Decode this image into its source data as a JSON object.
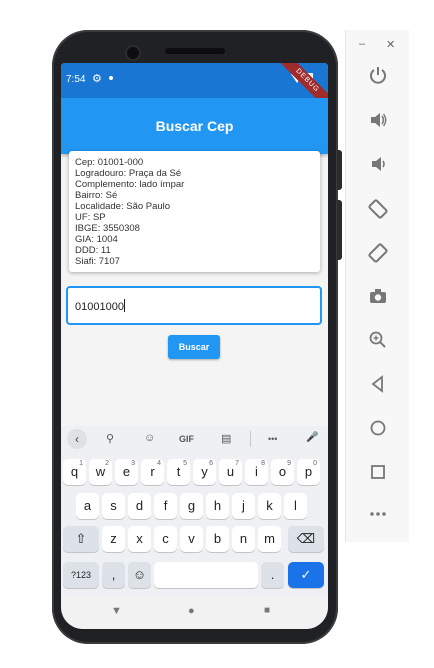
{
  "status_bar": {
    "time": "7:54",
    "debug_label": "DEBUG"
  },
  "app_bar": {
    "title": "Buscar Cep"
  },
  "result_lines": [
    "Cep: 01001-000",
    "Logradouro: Praça da Sé",
    "Complemento: lado ímpar",
    "Bairro: Sé",
    "Localidade: São Paulo",
    "UF: SP",
    "IBGE: 3550308",
    "GIA: 1004",
    "DDD: 11",
    "Siafi: 7107"
  ],
  "cep_input": {
    "value": "01001000"
  },
  "search_button": {
    "label": "Buscar"
  },
  "keyboard": {
    "toolbar": {
      "back": "‹",
      "search": "⚲",
      "sticker": "☺",
      "gif": "GIF",
      "clipboard": "▤",
      "more": "•••",
      "mic": "🎤"
    },
    "row1": [
      {
        "k": "q",
        "s": "1"
      },
      {
        "k": "w",
        "s": "2"
      },
      {
        "k": "e",
        "s": "3"
      },
      {
        "k": "r",
        "s": "4"
      },
      {
        "k": "t",
        "s": "5"
      },
      {
        "k": "y",
        "s": "6"
      },
      {
        "k": "u",
        "s": "7"
      },
      {
        "k": "i",
        "s": "8"
      },
      {
        "k": "o",
        "s": "9"
      },
      {
        "k": "p",
        "s": "0"
      }
    ],
    "row2": [
      "a",
      "s",
      "d",
      "f",
      "g",
      "h",
      "j",
      "k",
      "l"
    ],
    "row3": [
      "z",
      "x",
      "c",
      "v",
      "b",
      "n",
      "m"
    ],
    "shift": "⇧",
    "backspace": "⌫",
    "symbols": "?123",
    "comma": ",",
    "emoji": "☺",
    "period": ".",
    "enter": "✓"
  },
  "nav_bar": {
    "back": "▼",
    "home": "●",
    "recents": "■"
  },
  "emulator_panel": {
    "minimize": "–",
    "close": "✕",
    "icons": [
      "power-icon",
      "volume-up-icon",
      "volume-down-icon",
      "rotate-left-icon",
      "rotate-right-icon",
      "camera-icon",
      "zoom-icon",
      "back-icon",
      "home-icon",
      "overview-icon",
      "more-icon"
    ]
  },
  "colors": {
    "primary": "#2196f3",
    "status_bar": "#1976d2",
    "enter_key": "#1a73e8"
  }
}
